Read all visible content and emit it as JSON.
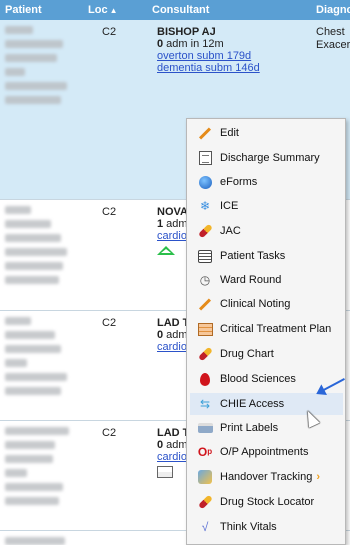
{
  "header": {
    "patient": "Patient",
    "loc": "Loc",
    "loc_sort": "▲",
    "consultant": "Consultant",
    "diagnosis": "Diagno"
  },
  "rows": [
    {
      "loc": "C2",
      "consultant": "BISHOP AJ",
      "adm_count": "0",
      "adm_text": " adm in 12m",
      "links": [
        "overton subm 179d",
        "dementia subm 146d"
      ],
      "diag_line1": "Chest",
      "diag_line2": "Exacer"
    },
    {
      "loc": "C2",
      "consultant": "NOVA",
      "adm_count": "1",
      "adm_text": " adm",
      "links": [
        "cardio"
      ]
    },
    {
      "loc": "C2",
      "consultant": "LAD T",
      "adm_count": "0",
      "adm_text": " adm",
      "links": [
        "cardio"
      ]
    },
    {
      "loc": "C2",
      "consultant": "LAD T",
      "adm_count": "0",
      "adm_text": " adm",
      "links": [
        "cardio"
      ]
    }
  ],
  "menu": {
    "items": [
      {
        "label": "Edit",
        "icon": "pencil-icon"
      },
      {
        "label": "Discharge Summary",
        "icon": "document-edit-icon"
      },
      {
        "label": "eForms",
        "icon": "globe-icon"
      },
      {
        "label": "ICE",
        "icon": "snowflake-icon"
      },
      {
        "label": "JAC",
        "icon": "pill-icon"
      },
      {
        "label": "Patient Tasks",
        "icon": "list-icon"
      },
      {
        "label": "Ward Round",
        "icon": "clock-icon"
      },
      {
        "label": "Clinical Noting",
        "icon": "pencil-icon"
      },
      {
        "label": "Critical Treatment Plan",
        "icon": "chart-icon"
      },
      {
        "label": "Drug Chart",
        "icon": "pill-icon"
      },
      {
        "label": "Blood Sciences",
        "icon": "blood-drop-icon"
      },
      {
        "label": "CHIE Access",
        "icon": "link-icon"
      },
      {
        "label": "Print Labels",
        "icon": "printer-icon"
      },
      {
        "label": "O/P Appointments",
        "icon": "op-icon"
      },
      {
        "label": "Handover Tracking",
        "icon": "handover-icon",
        "chevron": "›"
      },
      {
        "label": "Drug Stock Locator",
        "icon": "pill-icon"
      },
      {
        "label": "Think Vitals",
        "icon": "vitals-icon"
      }
    ]
  },
  "colors": {
    "header_bg": "#5a9fd4",
    "selected_row_bg": "#d4eaf7",
    "link": "#2b52c9",
    "menu_bg": "#f5f5f5",
    "hover_bg": "#dfe9f5",
    "annotation_arrow": "#2a66d8"
  }
}
